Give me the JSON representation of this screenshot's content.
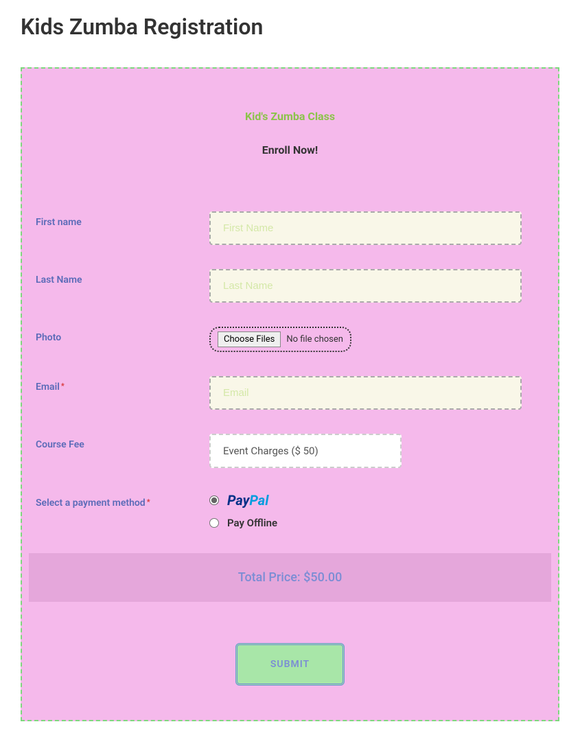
{
  "page": {
    "title": "Kids Zumba Registration"
  },
  "form": {
    "title": "Kid's Zumba Class",
    "subtitle": "Enroll Now!",
    "firstName": {
      "label": "First name",
      "placeholder": "First Name",
      "value": ""
    },
    "lastName": {
      "label": "Last Name",
      "placeholder": "Last Name",
      "value": ""
    },
    "photo": {
      "label": "Photo",
      "buttonText": "Choose Files",
      "status": "No file chosen"
    },
    "email": {
      "label": "Email",
      "placeholder": "Email",
      "value": ""
    },
    "courseFee": {
      "label": "Course Fee",
      "selected": "Event Charges ($ 50)"
    },
    "paymentMethod": {
      "label": "Select a payment method",
      "paypal": {
        "part1": "Pay",
        "part2": "Pal"
      },
      "offline": "Pay Offline"
    },
    "totalPrice": {
      "label": "Total Price:",
      "amount": "$50.00"
    },
    "submit": "SUBMIT"
  }
}
